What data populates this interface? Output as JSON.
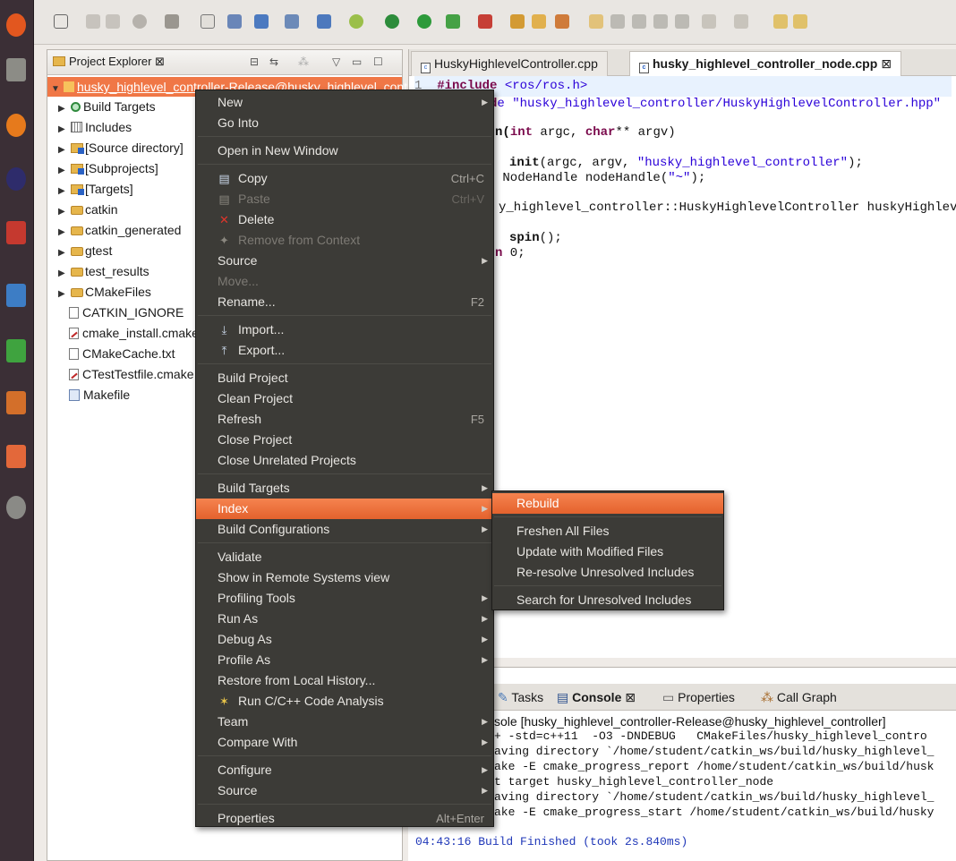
{
  "explorer": {
    "tab_label": "Project Explorer",
    "close_glyph": "⊠",
    "root": "husky_highlevel_controller-Release@husky_highlevel_controller",
    "items": [
      {
        "label": "Build Targets",
        "icon": "build-targets-icon"
      },
      {
        "label": "Includes",
        "icon": "includes-icon"
      },
      {
        "label": "[Source directory]",
        "icon": "source-directory-icon"
      },
      {
        "label": "[Subprojects]",
        "icon": "subprojects-icon"
      },
      {
        "label": "[Targets]",
        "icon": "targets-folder-icon"
      },
      {
        "label": "catkin",
        "icon": "folder-icon"
      },
      {
        "label": "catkin_generated",
        "icon": "folder-icon"
      },
      {
        "label": "gtest",
        "icon": "folder-icon"
      },
      {
        "label": "test_results",
        "icon": "folder-icon"
      },
      {
        "label": "CMakeFiles",
        "icon": "folder-icon"
      },
      {
        "label": "CATKIN_IGNORE",
        "icon": "file-icon"
      },
      {
        "label": "cmake_install.cmake",
        "icon": "cmake-file-icon"
      },
      {
        "label": "CMakeCache.txt",
        "icon": "file-icon"
      },
      {
        "label": "CTestTestfile.cmake",
        "icon": "cmake-file-icon"
      },
      {
        "label": "Makefile",
        "icon": "makefile-icon"
      }
    ]
  },
  "editor": {
    "tabs": [
      {
        "label": "HuskyHighlevelController.cpp",
        "active": false
      },
      {
        "label": "husky_highlevel_controller_node.cpp",
        "active": true
      }
    ],
    "close_glyph": "⊠",
    "line1_number": "1",
    "line1_kw": "#include",
    "line1_str": "<ros/ros.h>",
    "line2_tail": "e \"husky_highlevel_controller/HuskyHighlevelController.hpp\"",
    "line4_fn": "n(",
    "line4_kw1": "int",
    "line4_mid": " argc, ",
    "line4_kw2": "char",
    "line4_tail": "** argv)",
    "line6_fn": "init",
    "line6_mid": "(argc, argv, ",
    "line6_str": "\"husky_highlevel_controller\"",
    "line6_tail": ");",
    "line7_mid": " NodeHandle nodeHandle(",
    "line7_str": "\"~\"",
    "line7_tail": ");",
    "line9": "y_highlevel_controller::HuskyHighlevelController huskyHighlevel",
    "line11_fn": "spin",
    "line11_tail": "();",
    "line12_kw": "n",
    "line12_tail": " 0;"
  },
  "console": {
    "tabs": [
      "Tasks",
      "Console",
      "Properties",
      "Call Graph"
    ],
    "close_glyph": "⊠",
    "header": "sole [husky_highlevel_controller-Release@husky_highlevel_controller]",
    "lines": [
      "+ -std=c++11  -O3 -DNDEBUG   CMakeFiles/husky_highlevel_contro",
      "aving directory `/home/student/catkin_ws/build/husky_highlevel_",
      "ake -E cmake_progress_report /home/student/catkin_ws/build/husk",
      "t target husky_highlevel_controller_node",
      "aving directory `/home/student/catkin_ws/build/husky_highlevel_",
      "ake -E cmake_progress_start /home/student/catkin_ws/build/husky"
    ],
    "finished": "04:43:16 Build Finished (took 2s.840ms)"
  },
  "context_menu": {
    "items": [
      {
        "label": "New",
        "arrow": true
      },
      {
        "label": "Go Into"
      },
      {
        "sep": true
      },
      {
        "label": "Open in New Window"
      },
      {
        "sep": true
      },
      {
        "label": "Copy",
        "shortcut": "Ctrl+C",
        "icon": "copy-icon"
      },
      {
        "label": "Paste",
        "shortcut": "Ctrl+V",
        "icon": "paste-icon",
        "disabled": true
      },
      {
        "label": "Delete",
        "icon": "delete-icon"
      },
      {
        "label": "Remove from Context",
        "icon": "remove-context-icon",
        "disabled": true
      },
      {
        "label": "Source",
        "arrow": true
      },
      {
        "label": "Move...",
        "disabled": true
      },
      {
        "label": "Rename...",
        "shortcut": "F2"
      },
      {
        "sep": true
      },
      {
        "label": "Import...",
        "icon": "import-icon"
      },
      {
        "label": "Export...",
        "icon": "export-icon"
      },
      {
        "sep": true
      },
      {
        "label": "Build Project"
      },
      {
        "label": "Clean Project"
      },
      {
        "label": "Refresh",
        "shortcut": "F5"
      },
      {
        "label": "Close Project"
      },
      {
        "label": "Close Unrelated Projects"
      },
      {
        "sep": true
      },
      {
        "label": "Build Targets",
        "arrow": true
      },
      {
        "label": "Index",
        "arrow": true,
        "highlighted": true
      },
      {
        "label": "Build Configurations",
        "arrow": true
      },
      {
        "sep": true
      },
      {
        "label": "Validate"
      },
      {
        "label": "Show in Remote Systems view"
      },
      {
        "label": "Profiling Tools",
        "arrow": true
      },
      {
        "label": "Run As",
        "arrow": true
      },
      {
        "label": "Debug As",
        "arrow": true
      },
      {
        "label": "Profile As",
        "arrow": true
      },
      {
        "label": "Restore from Local History..."
      },
      {
        "label": "Run C/C++ Code Analysis",
        "icon": "code-analysis-icon"
      },
      {
        "label": "Team",
        "arrow": true
      },
      {
        "label": "Compare With",
        "arrow": true
      },
      {
        "sep": true
      },
      {
        "label": "Configure",
        "arrow": true
      },
      {
        "label": "Source",
        "arrow": true
      },
      {
        "sep": true
      },
      {
        "label": "Properties",
        "shortcut": "Alt+Enter"
      }
    ]
  },
  "index_submenu": {
    "items": [
      {
        "label": "Rebuild",
        "highlighted": true
      },
      {
        "sep": true
      },
      {
        "label": "Freshen All Files"
      },
      {
        "label": "Update with Modified Files"
      },
      {
        "label": "Re-resolve Unresolved Includes"
      },
      {
        "sep": true
      },
      {
        "label": "Search for Unresolved Includes"
      }
    ]
  },
  "colors": {
    "accent": "#f07746",
    "menu_bg": "#3c3b37",
    "launcher_bg": "#3b2f36"
  }
}
